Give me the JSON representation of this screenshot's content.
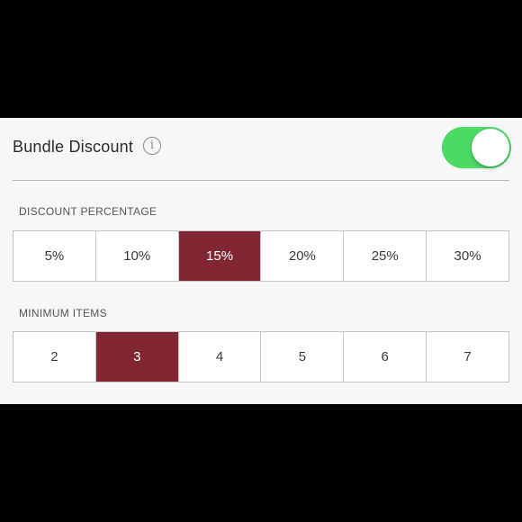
{
  "header": {
    "title": "Bundle Discount",
    "info_glyph": "i",
    "toggle_on": true
  },
  "discount": {
    "label": "DISCOUNT PERCENTAGE",
    "options": [
      "5%",
      "10%",
      "15%",
      "20%",
      "25%",
      "30%"
    ],
    "selected": "15%"
  },
  "minimum": {
    "label": "MINIMUM ITEMS",
    "options": [
      "2",
      "3",
      "4",
      "5",
      "6",
      "7"
    ],
    "selected": "3"
  },
  "colors": {
    "accent": "#832634",
    "toggle_on": "#4cd964"
  },
  "icons": {
    "info": "info-icon"
  }
}
